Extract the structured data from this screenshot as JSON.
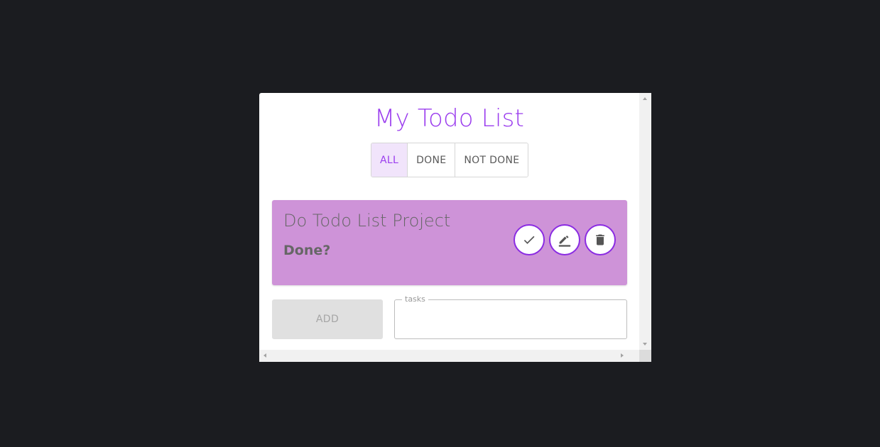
{
  "app": {
    "title": "My Todo List"
  },
  "filters": [
    {
      "label": "ALL",
      "active": true
    },
    {
      "label": "DONE",
      "active": false
    },
    {
      "label": "NOT DONE",
      "active": false
    }
  ],
  "todos": [
    {
      "title": "Do Todo List Project",
      "status_label": "Done?",
      "actions": [
        "check-icon",
        "edit-icon",
        "delete-icon"
      ]
    }
  ],
  "form": {
    "add_label": "ADD",
    "input_legend": "tasks",
    "input_value": ""
  },
  "colors": {
    "accent": "#9b3dee",
    "card_background": "#ce93d8",
    "backdrop": "#1b1c20",
    "action_border": "#8a2be2"
  }
}
